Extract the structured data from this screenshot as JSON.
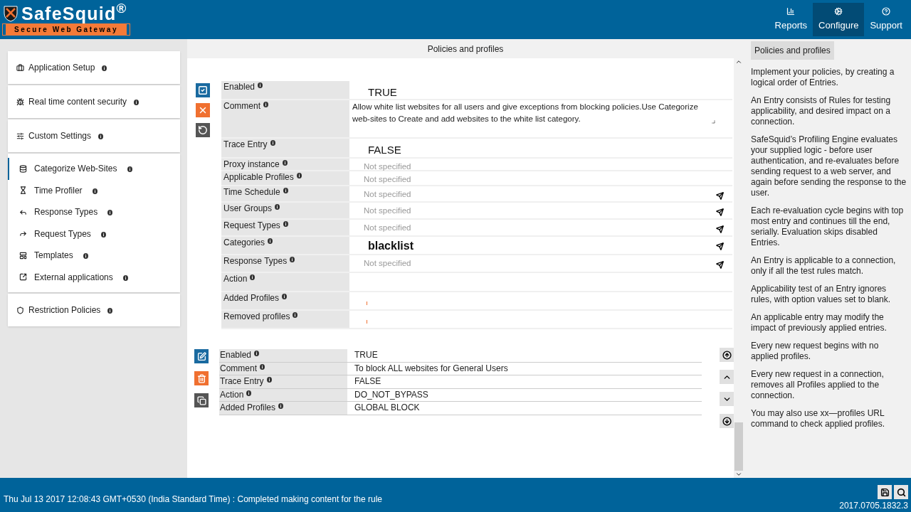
{
  "header": {
    "logo_title": "SafeSquid$^{®}$",
    "logo_subtitle": "Secure Web Gateway",
    "nav": [
      {
        "label": "Reports",
        "selected": false
      },
      {
        "label": "Configure",
        "selected": true
      },
      {
        "label": "Support",
        "selected": false
      }
    ]
  },
  "sidebar": {
    "items": [
      {
        "label": "Application Setup"
      },
      {
        "label": "Real time content security"
      },
      {
        "label": "Custom Settings",
        "children": [
          {
            "label": "Categorize Web-Sites",
            "selected": true
          },
          {
            "label": "Time Profiler",
            "selected": false
          },
          {
            "label": "Response Types",
            "selected": false
          },
          {
            "label": "Request Types",
            "selected": false
          },
          {
            "label": "Templates",
            "selected": false
          },
          {
            "label": "External applications",
            "selected": false
          }
        ]
      },
      {
        "label": "Restriction Policies"
      }
    ]
  },
  "page_title": "Policies and profiles",
  "editor": {
    "rows": [
      {
        "label": "Enabled",
        "kind": "big",
        "value": "TRUE"
      },
      {
        "label": "Comment",
        "kind": "textarea",
        "value": "Allow white list websites for all users and give exceptions from blocking policies.Use Categorize web-sites to Create and add websites to the white list category."
      },
      {
        "label": "Trace Entry",
        "kind": "big",
        "value": "FALSE"
      },
      {
        "label": "Proxy instance",
        "kind": "unset",
        "placeholder": "Not specified",
        "picker": false
      },
      {
        "label": "Applicable Profiles",
        "kind": "unset",
        "placeholder": "Not specified",
        "picker": false
      },
      {
        "label": "Time Schedule",
        "kind": "unset",
        "placeholder": "Not specified",
        "picker": true
      },
      {
        "label": "User Groups",
        "kind": "unset",
        "placeholder": "Not specified",
        "picker": true
      },
      {
        "label": "Request Types",
        "kind": "unset",
        "placeholder": "Not specified",
        "picker": true
      },
      {
        "label": "Categories",
        "kind": "bold",
        "value": "blacklist",
        "picker": true
      },
      {
        "label": "Response Types",
        "kind": "unset",
        "placeholder": "Not specified",
        "picker": true
      },
      {
        "label": "Action",
        "kind": "empty"
      },
      {
        "label": "Added Profiles",
        "kind": "tags"
      },
      {
        "label": "Removed profiles",
        "kind": "tags"
      }
    ]
  },
  "entry": {
    "rows": [
      {
        "label": "Enabled",
        "value": "TRUE"
      },
      {
        "label": "Comment",
        "value": "To block ALL websites for General Users"
      },
      {
        "label": "Trace Entry",
        "value": "FALSE"
      },
      {
        "label": "Action",
        "value": "DO_NOT_BYPASS"
      },
      {
        "label": "Added Profiles",
        "value": "GLOBAL BLOCK"
      }
    ]
  },
  "help": {
    "title": "Policies and profiles",
    "paragraphs": [
      "Implement your policies, by creating a logical order of Entries.",
      "An Entry consists of Rules for testing applicability, and desired impact on a connection.",
      "SafeSquid’s Profiling Engine evaluates your supplied logic - before user authentication, and re-evaluates before sending request to a web server, and again before sending the response to the user.",
      "Each re-evaluation cycle begins with top most entry and continues till the end, serially. Evaluation skips disabled Entries.",
      "An Entry is applicable to a connection, only if all the test rules match.",
      "Applicability test of an Entry ignores rules, with option values set to blank.",
      "An applicable entry may modify the impact of previously applied entries.",
      "Every new request begins with no applied profiles.",
      "Every new request in a connection, removes all Profiles applied to the connection.",
      "You may also use xx—profiles URL command to check applied profiles."
    ]
  },
  "status_bar": {
    "message": "Thu Jul 13 2017 12:08:43 GMT+0530 (India Standard Time) : Completed making content for the rule",
    "version": "2017.0705.1832.3"
  }
}
